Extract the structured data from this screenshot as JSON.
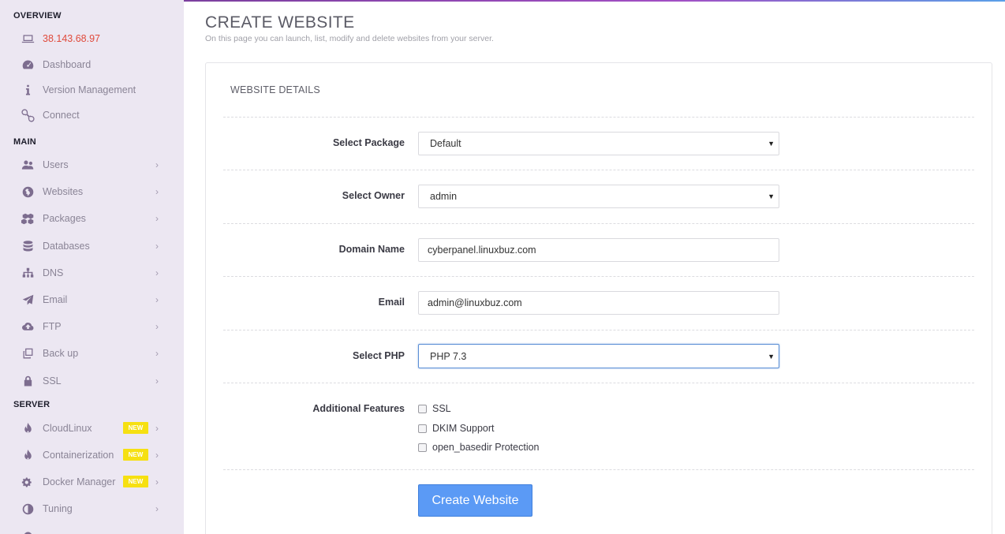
{
  "sidebar": {
    "overview_title": "OVERVIEW",
    "main_title": "MAIN",
    "server_title": "SERVER",
    "overview_items": [
      {
        "label": "38.143.68.97",
        "icon": "laptop-icon"
      },
      {
        "label": "Dashboard",
        "icon": "dashboard-icon"
      },
      {
        "label": "Version Management",
        "icon": "info-icon"
      },
      {
        "label": "Connect",
        "icon": "link-icon"
      }
    ],
    "main_items": [
      {
        "label": "Users",
        "icon": "users-icon"
      },
      {
        "label": "Websites",
        "icon": "globe-icon"
      },
      {
        "label": "Packages",
        "icon": "cubes-icon"
      },
      {
        "label": "Databases",
        "icon": "database-icon"
      },
      {
        "label": "DNS",
        "icon": "sitemap-icon"
      },
      {
        "label": "Email",
        "icon": "paper-plane-icon"
      },
      {
        "label": "FTP",
        "icon": "cloud-upload-icon"
      },
      {
        "label": "Back up",
        "icon": "clone-icon"
      },
      {
        "label": "SSL",
        "icon": "lock-icon"
      }
    ],
    "server_items": [
      {
        "label": "CloudLinux",
        "icon": "fire-icon",
        "badge": "NEW"
      },
      {
        "label": "Containerization",
        "icon": "fire-icon",
        "badge": "NEW"
      },
      {
        "label": "Docker Manager",
        "icon": "cogs-icon",
        "badge": "NEW"
      },
      {
        "label": "Tuning",
        "icon": "adjust-icon"
      }
    ],
    "chevron": "›"
  },
  "page": {
    "title": "CREATE WEBSITE",
    "subtitle": "On this page you can launch, list, modify and delete websites from your server."
  },
  "form": {
    "panel_title": "WEBSITE DETAILS",
    "package_label": "Select Package",
    "package_value": "Default",
    "owner_label": "Select Owner",
    "owner_value": "admin",
    "domain_label": "Domain Name",
    "domain_value": "cyberpanel.linuxbuz.com",
    "email_label": "Email",
    "email_value": "admin@linuxbuz.com",
    "php_label": "Select PHP",
    "php_value": "PHP 7.3",
    "features_label": "Additional Features",
    "features": [
      {
        "label": "SSL",
        "checked": false
      },
      {
        "label": "DKIM Support",
        "checked": false
      },
      {
        "label": "open_basedir Protection",
        "checked": false
      }
    ],
    "submit_label": "Create Website"
  },
  "colors": {
    "sidebar_bg": "#ece7f2",
    "accent_button": "#5b9af5",
    "ip_text": "#e04a3b",
    "badge": "#f6e012"
  }
}
